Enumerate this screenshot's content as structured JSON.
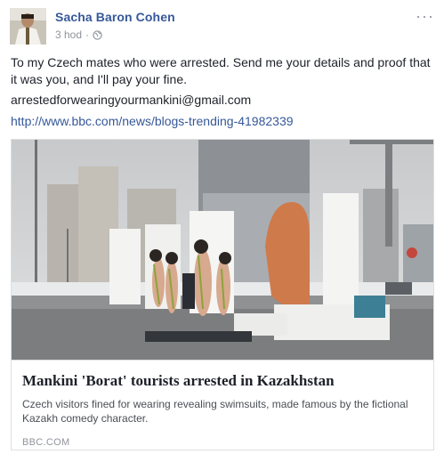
{
  "post": {
    "author": "Sacha Baron Cohen",
    "time": "3 hod",
    "separator": "·",
    "privacy_icon": "globe-icon",
    "more_label": "···",
    "text": "To my Czech mates who were arrested. Send me your details and proof that it was you, and I'll pay your fine.",
    "email": "arrestedforwearingyourmankini@gmail.com",
    "link": "http://www.bbc.com/news/blogs-trending-41982339"
  },
  "card": {
    "title": "Mankini 'Borat' tourists arrested in Kazakhstan",
    "description": "Czech visitors fined for wearing revealing swimsuits, made famous by the fictional Kazakh comedy character.",
    "domain": "BBC.COM"
  },
  "colors": {
    "link": "#365899",
    "text": "#1d2129",
    "muted": "#90949c",
    "border": "#dddfe2"
  }
}
